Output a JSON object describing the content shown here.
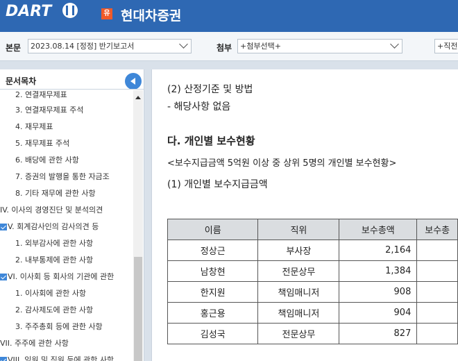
{
  "header": {
    "logo": "DART",
    "corp_badge": "유",
    "company": "현대차증권"
  },
  "toolbar": {
    "body_label": "본문",
    "report_select": "2023.08.14 [정정] 반기보고서",
    "attach_label": "첨부",
    "attach_select": "+첨부선택+",
    "extra_select": "+직전"
  },
  "sidebar": {
    "title": "문서목차",
    "items": [
      {
        "label": "2. 연결재무제표",
        "level": 2
      },
      {
        "label": "3. 연결재무제표 주석",
        "level": 2
      },
      {
        "label": "4. 재무제표",
        "level": 2
      },
      {
        "label": "5. 재무제표 주석",
        "level": 2
      },
      {
        "label": "6. 배당에 관한 사항",
        "level": 2
      },
      {
        "label": "7. 증권의 발행을 통한 자금조",
        "level": 2
      },
      {
        "label": "8. 기타 재무에 관한 사항",
        "level": 2
      },
      {
        "label": "IV. 이사의 경영진단 및 분석의견",
        "level": 1
      },
      {
        "label": "V. 회계감사인의 감사의견 등",
        "level": 1,
        "checked": true
      },
      {
        "label": "1. 외부감사에 관한 사항",
        "level": 2
      },
      {
        "label": "2. 내부통제에 관한 사항",
        "level": 2
      },
      {
        "label": "VI. 이사회 등 회사의 기관에 관한",
        "level": 1,
        "checked": true
      },
      {
        "label": "1. 이사회에 관한 사항",
        "level": 2
      },
      {
        "label": "2. 감사제도에 관한 사항",
        "level": 2
      },
      {
        "label": "3. 주주총회 등에 관한 사항",
        "level": 2
      },
      {
        "label": "VII. 주주에 관한 사항",
        "level": 1
      },
      {
        "label": "VIII. 임원 및 직원 등에 관한 사항",
        "level": 1,
        "checked": true
      }
    ]
  },
  "content": {
    "line1": "(2) 산정기준 및 방법",
    "line2": "- 해당사항 없음",
    "heading": "다. 개인별 보수현황",
    "subtitle": "<보수지급금액 5억원 이상 중 상위 5명의 개인별 보수현황>",
    "section": "(1) 개인별 보수지급금액",
    "table": {
      "headers": [
        "이름",
        "직위",
        "보수총액",
        "보수총"
      ],
      "rows": [
        [
          "정상근",
          "부사장",
          "2,164",
          ""
        ],
        [
          "남창현",
          "전문상무",
          "1,384",
          ""
        ],
        [
          "한지원",
          "책임매니저",
          "908",
          ""
        ],
        [
          "홍근용",
          "책임매니저",
          "904",
          ""
        ],
        [
          "김성국",
          "전문상무",
          "827",
          ""
        ]
      ]
    }
  }
}
